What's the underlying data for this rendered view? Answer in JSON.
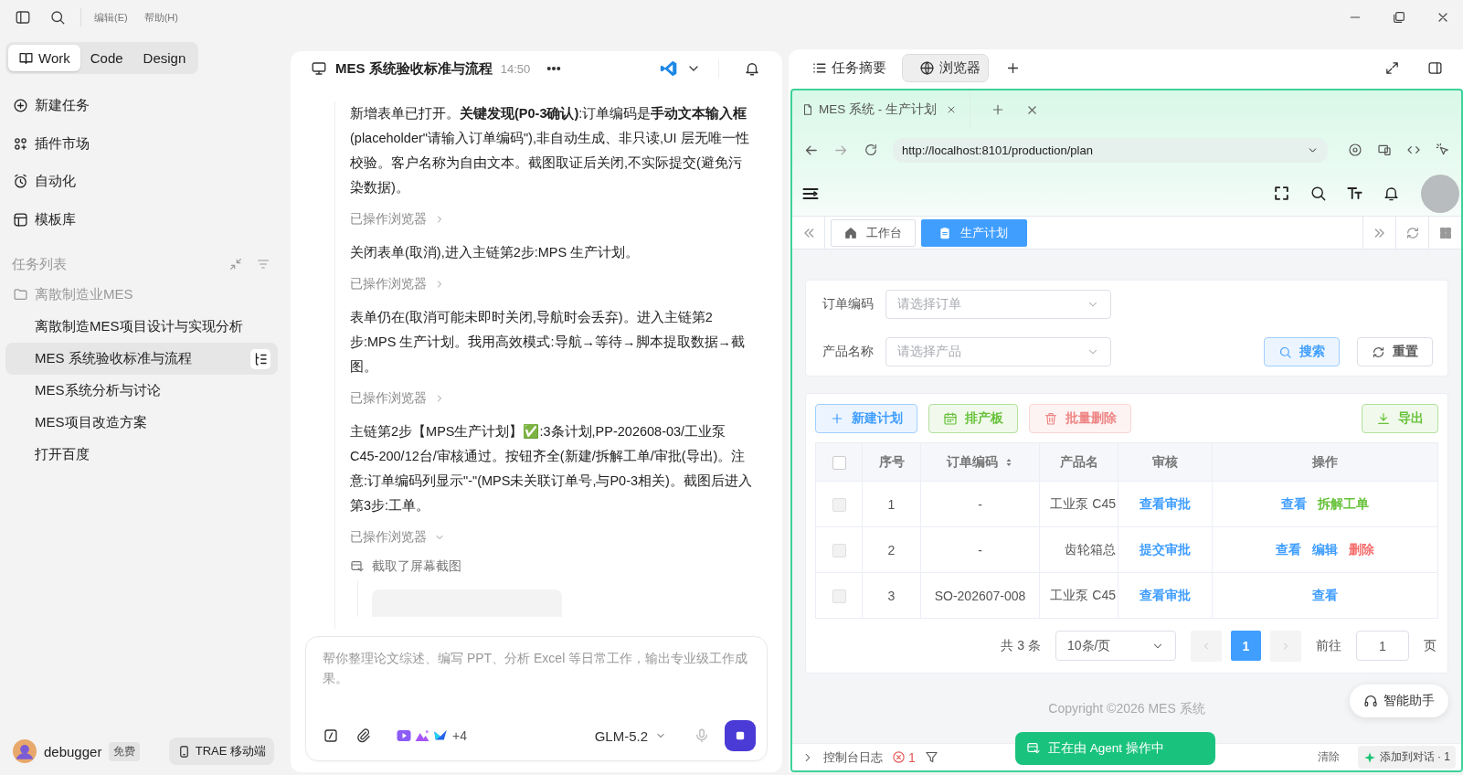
{
  "window": {
    "menus": [
      "编辑(E)",
      "帮助(H)"
    ]
  },
  "modes": [
    {
      "label": "Work",
      "selected": true
    },
    {
      "label": "Code",
      "selected": false
    },
    {
      "label": "Design",
      "selected": false
    }
  ],
  "nav": [
    "新建任务",
    "插件市场",
    "自动化",
    "模板库"
  ],
  "task_list": {
    "title": "任务列表",
    "folders": [
      {
        "label": "离散制造业MES",
        "children": [
          {
            "label": "离散制造MES项目设计与实现分析",
            "selected": false
          },
          {
            "label": "MES 系统验收标准与流程",
            "selected": true
          },
          {
            "label": "MES系统分析与讨论",
            "selected": false
          },
          {
            "label": "MES项目改造方案",
            "selected": false
          },
          {
            "label": "打开百度",
            "selected": false
          }
        ]
      }
    ]
  },
  "account": {
    "name": "debugger",
    "plan": "免费",
    "mobile_button": "TRAE 移动端"
  },
  "chat": {
    "title": "MES 系统验收标准与流程",
    "time": "14:50",
    "messages": [
      {
        "kind": "text",
        "text": "新增表单已打开。**关键发现(P0-3确认)**:订单编码是**手动文本输入框**(placeholder\"请输入订单编码\"),非自动生成、非只读,UI 层无唯一性校验。客户名称为自由文本。截图取证后关闭,不实际提交(避免污染数据)。"
      },
      {
        "kind": "action",
        "label": "已操作浏览器",
        "expanded": false
      },
      {
        "kind": "text",
        "text": "关闭表单(取消),进入主链第2步:MPS 生产计划。"
      },
      {
        "kind": "action",
        "label": "已操作浏览器",
        "expanded": false
      },
      {
        "kind": "text",
        "text": "表单仍在(取消可能未即时关闭,导航时会丢弃)。进入主链第2步:MPS 生产计划。我用高效模式:导航→等待→脚本提取数据→截图。"
      },
      {
        "kind": "action",
        "label": "已操作浏览器",
        "expanded": false
      },
      {
        "kind": "text",
        "text": "主链第2步【MPS生产计划】✅:3条计划,PP-202608-03/工业泵 C45-200/12台/审核通过。按钮齐全(新建/拆解工单/审批(导出)。注意:订单编码列显示\"-\"(MPS未关联订单号,与P0-3相关)。截图后进入第3步:工单。"
      },
      {
        "kind": "action",
        "label": "已操作浏览器",
        "expanded": true
      },
      {
        "kind": "screenshot",
        "label": "截取了屏幕截图"
      }
    ],
    "input": {
      "placeholder": "帮你整理论文综述、编写 PPT、分析 Excel 等日常工作，输出专业级工作成果。",
      "extra_tools": "+4",
      "model": "GLM-5.2"
    }
  },
  "side_panel": {
    "tabs": [
      {
        "label": "任务摘要",
        "selected": false
      },
      {
        "label": "浏览器",
        "selected": true
      }
    ],
    "browser": {
      "tab_title": "MES 系统 - 生产计划",
      "url": "http://localhost:8101/production/plan",
      "app": {
        "page_tabs": [
          {
            "label": "工作台",
            "selected": false
          },
          {
            "label": "生产计划",
            "selected": true
          }
        ],
        "filters": [
          {
            "label": "订单编码",
            "placeholder": "请选择订单"
          },
          {
            "label": "产品名称",
            "placeholder": "请选择产品"
          }
        ],
        "search_button": "搜索",
        "reset_button": "重置",
        "toolbar": [
          {
            "label": "新建计划",
            "kind": "primary",
            "disabled": false
          },
          {
            "label": "排产板",
            "kind": "success",
            "disabled": false
          },
          {
            "label": "批量删除",
            "kind": "danger",
            "disabled": true
          },
          {
            "label": "导出",
            "kind": "success",
            "disabled": false
          }
        ],
        "table": {
          "all_selected": false,
          "columns": [
            {
              "label": "序号",
              "sortable": false
            },
            {
              "label": "订单编码",
              "sortable": true
            },
            {
              "label": "产品名",
              "sortable": false
            },
            {
              "label": "审核",
              "sortable": false
            },
            {
              "label": "操作",
              "sortable": false
            }
          ],
          "rows": [
            {
              "selected": false,
              "cells": [
                "1",
                "-",
                "工业泵 C45"
              ],
              "review": "查看审批",
              "actions": [
                {
                  "label": "查看",
                  "kind": "primary"
                },
                {
                  "label": "拆解工单",
                  "kind": "success"
                }
              ]
            },
            {
              "selected": false,
              "cells": [
                "2",
                "-",
                "齿轮箱总"
              ],
              "review": "提交审批",
              "actions": [
                {
                  "label": "查看",
                  "kind": "primary"
                },
                {
                  "label": "编辑",
                  "kind": "primary"
                },
                {
                  "label": "删除",
                  "kind": "danger"
                }
              ]
            },
            {
              "selected": false,
              "cells": [
                "3",
                "SO-202607-008",
                "工业泵 C45"
              ],
              "review": "查看审批",
              "actions": [
                {
                  "label": "查看",
                  "kind": "primary"
                }
              ]
            }
          ]
        },
        "pagination": {
          "total": "共 3 条",
          "page_size": "10条/页",
          "pages": [
            {
              "label": "1",
              "selected": true
            }
          ],
          "goto_label": "前往",
          "goto_value": "1",
          "page_suffix": "页"
        },
        "copyright": "Copyright ©2026 MES 系统",
        "assistant": "智能助手"
      },
      "agent_status": "正在由 Agent 操作中",
      "console": {
        "label": "控制台日志",
        "errors": "1",
        "clear": "清除",
        "add": "添加到对话 · 1"
      }
    }
  }
}
